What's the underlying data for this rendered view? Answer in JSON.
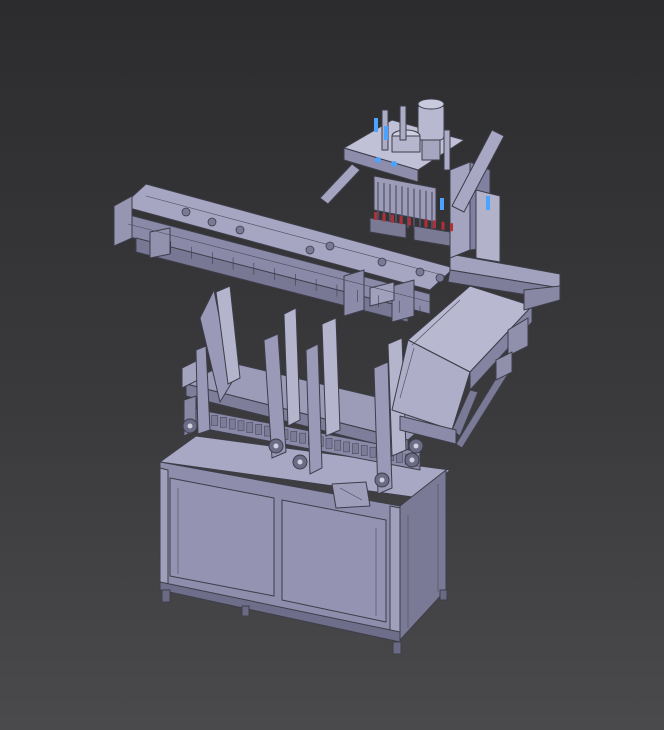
{
  "scene": {
    "background_top": "#2c2c2e",
    "background_bottom": "#4a4a4c",
    "body_color": "#9a9ab8",
    "body_light": "#b4b4cc",
    "body_dark": "#7c7c98",
    "accent_blue": "#4aa3ff",
    "accent_red": "#b0303a",
    "line_color": "#3d3d4a"
  },
  "parts": {
    "cabinet": "base-cabinet",
    "cabinet_doors": 2,
    "vertical_guides": 9,
    "mounting_feet": 4
  }
}
